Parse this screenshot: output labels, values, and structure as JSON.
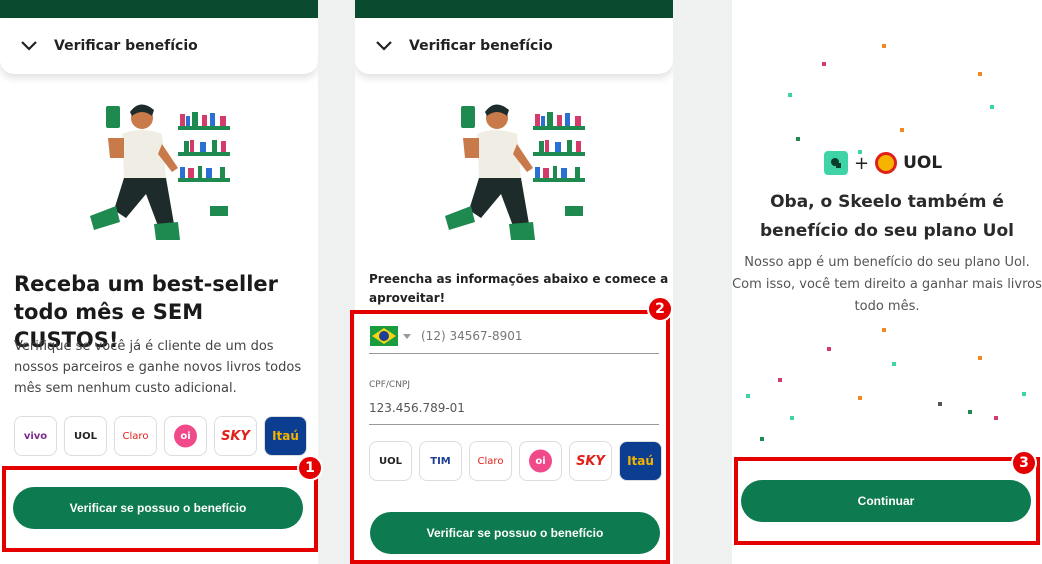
{
  "panel1": {
    "header_title": "Verificar benefício",
    "headline": "Receba um best-seller todo mês e SEM CUSTOS!",
    "body": "Verifique se você já é cliente de um dos nossos parceiros e ganhe novos livros todos mês sem nenhum custo adicional.",
    "partners": [
      "vivo",
      "UOL",
      "Claro",
      "oi",
      "SKY",
      "Itaú"
    ],
    "cta_label": "Verificar se possuo o benefício",
    "step_badge": "1"
  },
  "panel2": {
    "header_title": "Verificar benefício",
    "form_title": "Preencha as informações abaixo e comece a aproveitar!",
    "phone_placeholder": "(12) 34567-8901",
    "cpf_label": "CPF/CNPJ",
    "cpf_placeholder": "123.456.789-01",
    "partners": [
      "UOL",
      "TIM",
      "Claro",
      "oi",
      "SKY",
      "Itaú"
    ],
    "cta_label": "Verificar se possuo o benefício",
    "step_badge": "2"
  },
  "panel3": {
    "plus": "+",
    "partner_logo": "UOL",
    "title": "Oba, o Skeelo também é benefício do seu plano Uol",
    "body": "Nosso app é um benefício do seu plano Uol. Com isso, você tem direito a ganhar mais livros todo mês.",
    "cta_label": "Continuar",
    "step_badge": "3"
  },
  "colors": {
    "brand_green": "#0d7a4f",
    "header_dark": "#0a4a2e",
    "highlight_red": "#e50000"
  },
  "icons": {
    "chevron": "chevron-down-icon",
    "brazil_flag": "brazil-flag-icon",
    "dropdown": "caret-down-icon",
    "skeelo": "skeelo-logo-icon"
  }
}
